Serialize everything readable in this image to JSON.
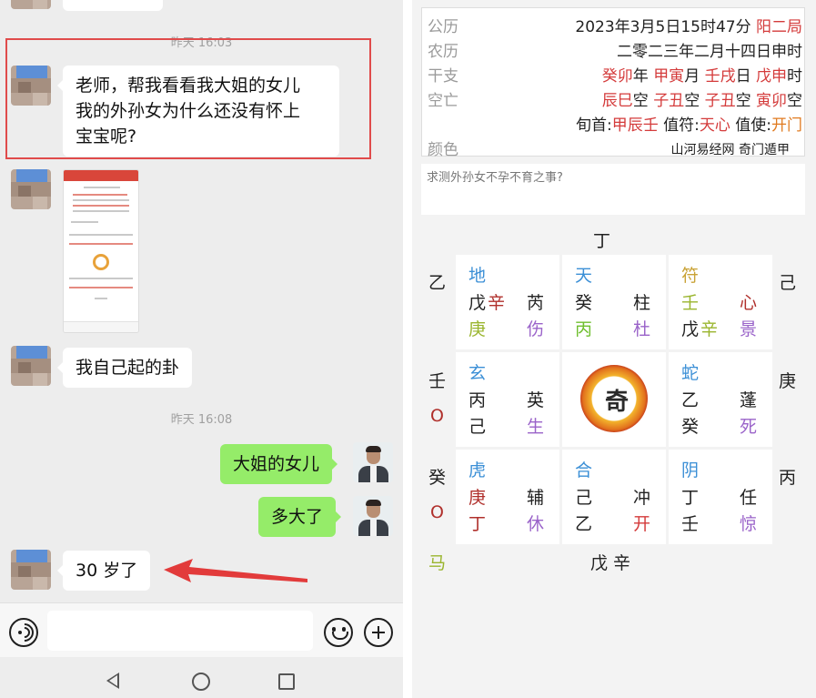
{
  "chat": {
    "times": [
      "昨天 16:03",
      "昨天 16:08"
    ],
    "messages": [
      {
        "side": "left",
        "text_lines": [
          "老师，帮我看看我大姐的女儿",
          "我的外孙女为什么还没有怀上",
          "宝宝呢?"
        ]
      },
      {
        "side": "left",
        "type": "image"
      },
      {
        "side": "left",
        "text": "我自己起的卦"
      },
      {
        "side": "right",
        "text": "大姐的女儿"
      },
      {
        "side": "right",
        "text": "多大了"
      },
      {
        "side": "left",
        "text": "30 岁了"
      }
    ],
    "colors": {
      "bubble_right": "#95ec69",
      "bubble_left": "#ffffff",
      "highlight": "#e04b4b",
      "background": "#ededed"
    },
    "icons": [
      "voice-icon",
      "emoji-icon",
      "plus-icon",
      "nav-back-icon",
      "nav-home-icon",
      "nav-recent-icon",
      "red-arrow-icon"
    ]
  },
  "chart": {
    "rows": [
      {
        "label": "公历",
        "parts": [
          {
            "t": "2023年3月5日15时47分 ",
            "c": "dark"
          },
          {
            "t": "阳二局",
            "c": "red"
          }
        ]
      },
      {
        "label": "农历",
        "parts": [
          {
            "t": "二零二三年二月十四日申时",
            "c": "dark"
          }
        ]
      },
      {
        "label": "干支",
        "parts": [
          {
            "t": "癸卯",
            "c": "red"
          },
          {
            "t": "年 ",
            "c": "dark"
          },
          {
            "t": "甲寅",
            "c": "red"
          },
          {
            "t": "月 ",
            "c": "dark"
          },
          {
            "t": "壬戌",
            "c": "red"
          },
          {
            "t": "日 ",
            "c": "dark"
          },
          {
            "t": "戊申",
            "c": "red"
          },
          {
            "t": "时",
            "c": "dark"
          }
        ]
      },
      {
        "label": "空亡",
        "parts": [
          {
            "t": "辰巳",
            "c": "red"
          },
          {
            "t": "空 ",
            "c": "dark"
          },
          {
            "t": "子丑",
            "c": "red"
          },
          {
            "t": "空 ",
            "c": "dark"
          },
          {
            "t": "子丑",
            "c": "red"
          },
          {
            "t": "空 ",
            "c": "dark"
          },
          {
            "t": "寅卯",
            "c": "red"
          },
          {
            "t": "空",
            "c": "dark"
          }
        ]
      },
      {
        "label": "",
        "parts": [
          {
            "t": "旬首:",
            "c": "dark"
          },
          {
            "t": "甲辰壬",
            "c": "red"
          },
          {
            "t": " 值符:",
            "c": "dark"
          },
          {
            "t": "天心",
            "c": "red"
          },
          {
            "t": " 值使:",
            "c": "dark"
          },
          {
            "t": "开门",
            "c": "org"
          }
        ]
      },
      {
        "label": "颜色",
        "parts": [
          {
            "t": "山河易经网  奇门遁甲",
            "c": "dark"
          }
        ]
      }
    ],
    "question": "求测外孙女不孕不育之事?",
    "top_label": "丁",
    "bottom_label": "戊 辛",
    "left_labels": [
      "乙",
      "壬",
      "O",
      "癸",
      "O",
      "马"
    ],
    "right_labels": [
      "己",
      "庚",
      "丙"
    ],
    "center_glyph": "奇",
    "cells": [
      {
        "spirit": "地",
        "spirit_c": "blue",
        "r1": [
          {
            "t": "戊",
            "c": "dark"
          },
          {
            "t": "辛",
            "c": "dred"
          }
        ],
        "r1r": {
          "t": "芮",
          "c": "dark"
        },
        "r2": [
          {
            "t": "庚",
            "c": "olive"
          }
        ],
        "r2r": {
          "t": "伤",
          "c": "purple"
        }
      },
      {
        "spirit": "天",
        "spirit_c": "blue",
        "r1": [
          {
            "t": "癸",
            "c": "dark"
          }
        ],
        "r1r": {
          "t": "柱",
          "c": "dark"
        },
        "r2": [
          {
            "t": "丙",
            "c": "green"
          }
        ],
        "r2r": {
          "t": "杜",
          "c": "purple"
        }
      },
      {
        "spirit": "符",
        "spirit_c": "gold",
        "r1": [
          {
            "t": "壬",
            "c": "olive"
          }
        ],
        "r1r": {
          "t": "心",
          "c": "dred"
        },
        "r2": [
          {
            "t": "戊",
            "c": "dark"
          },
          {
            "t": "辛",
            "c": "olive"
          }
        ],
        "r2r": {
          "t": "景",
          "c": "purple"
        }
      },
      {
        "spirit": "玄",
        "spirit_c": "blue",
        "r1": [
          {
            "t": "丙",
            "c": "dark"
          }
        ],
        "r1r": {
          "t": "英",
          "c": "dark"
        },
        "r2": [
          {
            "t": "己",
            "c": "dark"
          }
        ],
        "r2r": {
          "t": "生",
          "c": "purple"
        }
      },
      {
        "center": true
      },
      {
        "spirit": "蛇",
        "spirit_c": "blue",
        "r1": [
          {
            "t": "乙",
            "c": "dark"
          }
        ],
        "r1r": {
          "t": "蓬",
          "c": "dark"
        },
        "r2": [
          {
            "t": "癸",
            "c": "dark"
          }
        ],
        "r2r": {
          "t": "死",
          "c": "purple"
        }
      },
      {
        "spirit": "虎",
        "spirit_c": "blue",
        "r1": [
          {
            "t": "庚",
            "c": "dred"
          }
        ],
        "r1r": {
          "t": "辅",
          "c": "dark"
        },
        "r2": [
          {
            "t": "丁",
            "c": "dred"
          }
        ],
        "r2r": {
          "t": "休",
          "c": "purple"
        }
      },
      {
        "spirit": "合",
        "spirit_c": "blue",
        "r1": [
          {
            "t": "己",
            "c": "dark"
          }
        ],
        "r1r": {
          "t": "冲",
          "c": "dark"
        },
        "r2": [
          {
            "t": "乙",
            "c": "dark"
          }
        ],
        "r2r": {
          "t": "开",
          "c": "red"
        }
      },
      {
        "spirit": "阴",
        "spirit_c": "blue",
        "r1": [
          {
            "t": "丁",
            "c": "dark"
          }
        ],
        "r1r": {
          "t": "任",
          "c": "dark"
        },
        "r2": [
          {
            "t": "壬",
            "c": "dark"
          }
        ],
        "r2r": {
          "t": "惊",
          "c": "purple"
        }
      }
    ]
  }
}
